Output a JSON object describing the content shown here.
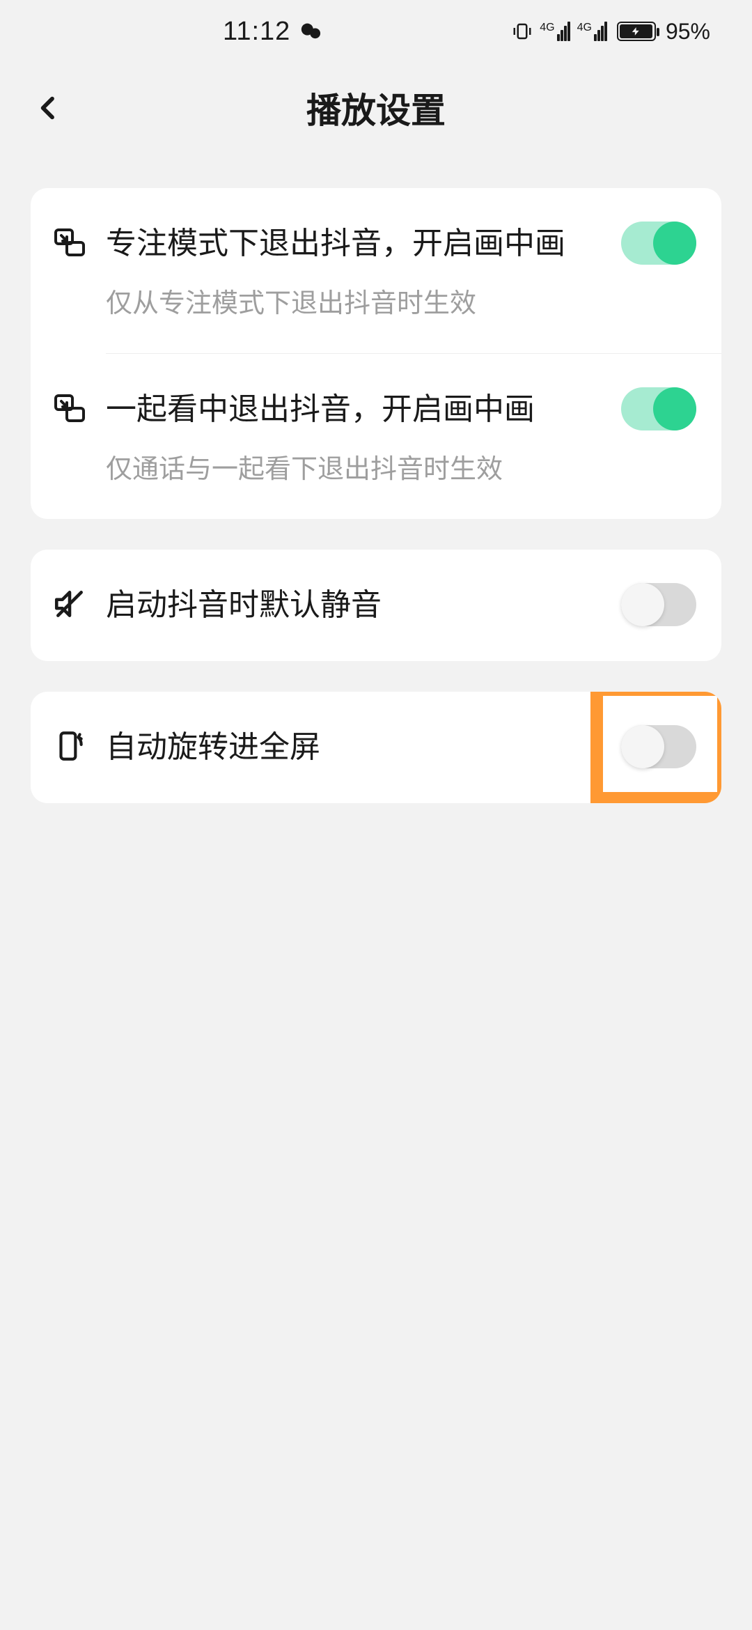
{
  "status_bar": {
    "time": "11:12",
    "signal1_label": "4G",
    "signal2_label": "4G",
    "battery_percent": "95%"
  },
  "nav": {
    "title": "播放设置"
  },
  "group1": {
    "item1": {
      "title": "专注模式下退出抖音，开启画中画",
      "desc": "仅从专注模式下退出抖音时生效",
      "toggle_on": true
    },
    "item2": {
      "title": "一起看中退出抖音，开启画中画",
      "desc": "仅通话与一起看下退出抖音时生效",
      "toggle_on": true
    }
  },
  "group2": {
    "item1": {
      "title": "启动抖音时默认静音",
      "toggle_on": false
    }
  },
  "group3": {
    "item1": {
      "title": "自动旋转进全屏",
      "toggle_on": false
    }
  }
}
